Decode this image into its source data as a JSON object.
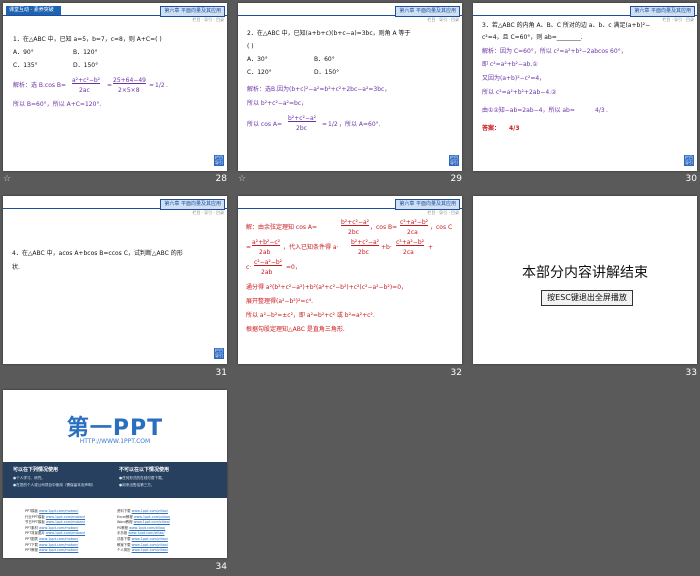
{
  "header": {
    "chapter": "第六章  平面向量及其应用",
    "sublinks": "栏目 · 导引 · 目录",
    "section_label": "课堂互动 · 素养突破"
  },
  "next_button": "栏目导引",
  "slides": [
    {
      "number": "28",
      "lines": [
        "1．在△ABC 中，已知 a=5，b=7，c=8，则 A+C=(     )",
        "A．90°",
        "B．120°",
        "C．135°",
        "D．150°",
        "解析：选 B.cos B=",
        "a²+c²−b²",
        "2ac",
        "=",
        "25+64−49",
        "2×5×8",
        "=",
        "1/2",
        ".",
        "所以 B=60°，所以 A+C=120°."
      ]
    },
    {
      "number": "29",
      "lines": [
        "2．在△ABC 中，已知(a+b+c)(b+c−a)=3bc，则角 A 等于",
        "(     )",
        "A．30°",
        "B．60°",
        "C．120°",
        "D．150°",
        "解析：选B.因为(b+c)²−a²=b²+c²+2bc−a²=3bc，",
        "所以 b²+c²−a²=bc，",
        "所以 cos A=",
        "b²+c²−a²",
        "2bc",
        "=",
        "1/2",
        "，所以 A=60°."
      ]
    },
    {
      "number": "30",
      "lines": [
        "3．若△ABC 的内角 A、B、C 所对的边 a、b、c 满足(a+b)²−",
        "c²=4，且 C=60°，则 ab=________.",
        "解析：因为 C=60°，所以 c²=a²+b²−2abcos 60°，",
        "即 c²=a²+b²−ab.①",
        "又因为(a+b)²−c²=4，",
        "所以 c²=a²+b²+2ab−4.②",
        "由①②知−ab=2ab−4，所以 ab=",
        "4/3",
        ".",
        "答案：",
        "4/3"
      ]
    },
    {
      "number": "31",
      "lines": [
        "4．在△ABC 中，acos A+bcos B=ccos C，试判断△ABC 的形",
        "状."
      ]
    },
    {
      "number": "32",
      "lines": [
        "解：由余弦定理知 cos A=",
        "b²+c²−a²",
        "2bc",
        "，cos B=",
        "c²+a²−b²",
        "2ca",
        "，cos C",
        "=",
        "a²+b²−c²",
        "2ab",
        "，代入已知条件得 a·",
        "b²+c²−a²",
        "2bc",
        "+b·",
        "c²+a²−b²",
        "2ca",
        "+",
        "c·",
        "c²−a²−b²",
        "2ab",
        "=0，",
        "通分得 a²(b²+c²−a²)+b²(a²+c²−b²)+c²(c²−a²−b²)=0，",
        "展开整理得(a²−b²)²=c⁴.",
        "所以 a²−b²=±c²，即 a²=b²+c² 或 b²=a²+c².",
        "根据勾股定理知△ABC 是直角三角形."
      ]
    },
    {
      "number": "33",
      "title": "本部分内容讲解结束",
      "button": "按ESC键退出全屏播放"
    },
    {
      "number": "34",
      "logo": "第一PPT",
      "url": "HTTP://WWW.1PPT.COM",
      "band_left_title": "可以在下列情况使用",
      "band_left_lines": [
        "●个人学习、研究。",
        "●在您的个人或公司项目中使用（需保留本页声明）"
      ],
      "band_right_title": "不可以在以下情况使用",
      "band_right_lines": [
        "●任何形式的在线付费下载。",
        "●用来出售给第三方。"
      ],
      "links_left": [
        "PPT模板",
        "行业PPT模板",
        "节日PPT模板",
        "PPT素材",
        "PPT背景图片",
        "PPT图表",
        "PPT下载",
        "PPT教程"
      ],
      "links_left_url": "www.1ppt.com/moban/",
      "links_right": [
        "资料下载",
        "Excel教程",
        "Word教程",
        "PS教程",
        "手抄报",
        "试卷下载",
        "教案下载",
        "个人简历"
      ],
      "links_right_url": "www.1ppt.com/ziliao/"
    }
  ]
}
